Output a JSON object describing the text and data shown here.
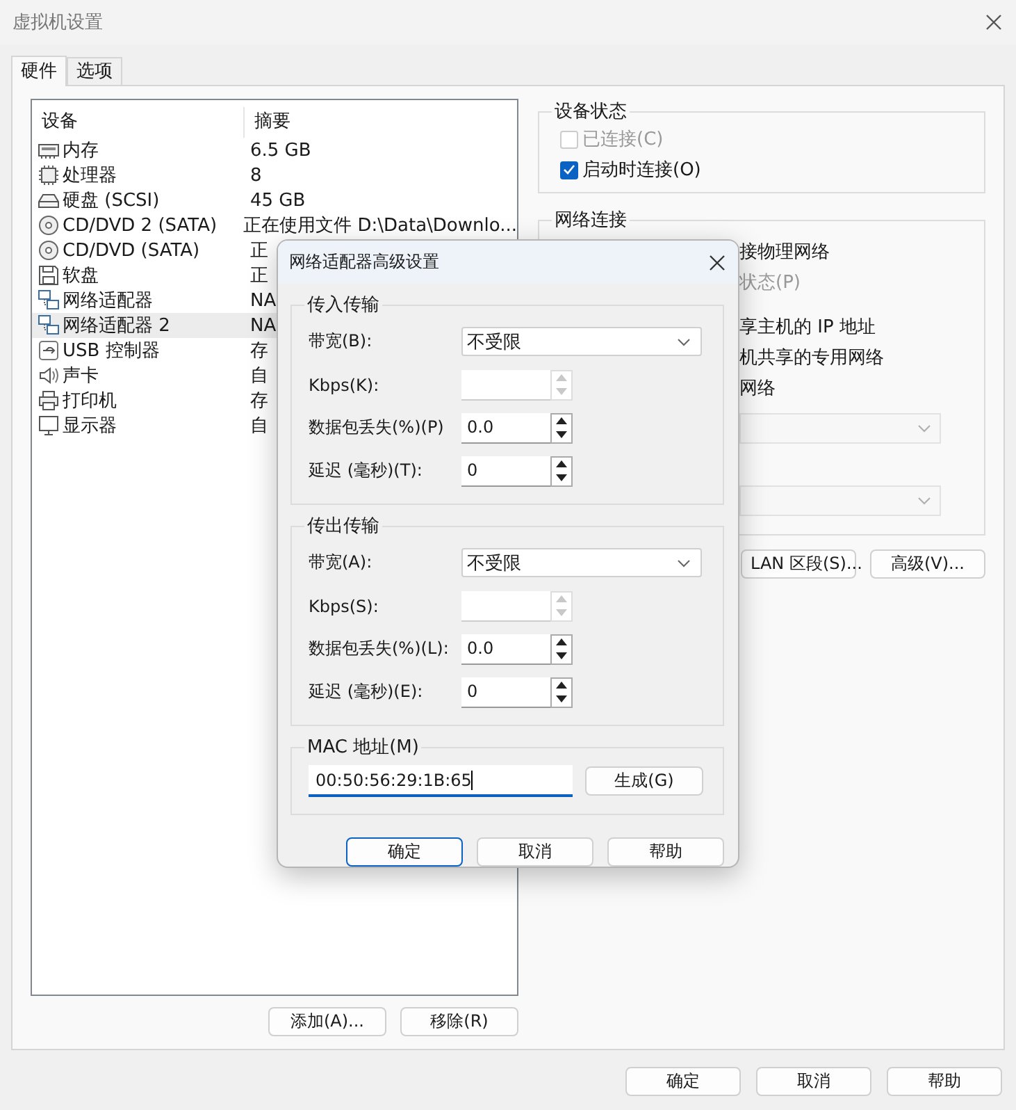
{
  "window": {
    "title": "虚拟机设置"
  },
  "tabs": [
    {
      "label": "硬件",
      "selected": true
    },
    {
      "label": "选项",
      "selected": false
    }
  ],
  "device_list": {
    "columns": [
      "设备",
      "摘要"
    ],
    "rows": [
      {
        "kind": "memory",
        "device": "内存",
        "summary": "6.5 GB",
        "selected": false
      },
      {
        "kind": "cpu",
        "device": "处理器",
        "summary": "8",
        "selected": false
      },
      {
        "kind": "disk",
        "device": "硬盘 (SCSI)",
        "summary": "45 GB",
        "selected": false
      },
      {
        "kind": "cdrom",
        "device": "CD/DVD 2 (SATA)",
        "summary": "正在使用文件 D:\\Data\\Downlo...",
        "selected": false
      },
      {
        "kind": "cdrom",
        "device": "CD/DVD (SATA)",
        "summary": "正",
        "selected": false
      },
      {
        "kind": "floppy",
        "device": "软盘",
        "summary": "正",
        "selected": false
      },
      {
        "kind": "network",
        "device": "网络适配器",
        "summary": "NA",
        "selected": false
      },
      {
        "kind": "network",
        "device": "网络适配器 2",
        "summary": "NA",
        "selected": true
      },
      {
        "kind": "usb",
        "device": "USB 控制器",
        "summary": "存",
        "selected": false
      },
      {
        "kind": "sound",
        "device": "声卡",
        "summary": "自",
        "selected": false
      },
      {
        "kind": "printer",
        "device": "打印机",
        "summary": "存",
        "selected": false
      },
      {
        "kind": "display",
        "device": "显示器",
        "summary": "自",
        "selected": false
      }
    ]
  },
  "list_buttons": [
    "添加(A)...",
    "移除(R)"
  ],
  "device_status": {
    "title": "设备状态",
    "options": [
      {
        "label": "已连接(C)",
        "checked": false,
        "disabled": true
      },
      {
        "label": "启动时连接(O)",
        "checked": true,
        "disabled": false
      }
    ]
  },
  "network_connection": {
    "title": "网络连接",
    "items": [
      {
        "kind": "text",
        "text": "接物理网络",
        "disabled": false
      },
      {
        "kind": "text",
        "text": "状态(P)",
        "disabled": true
      },
      {
        "kind": "text",
        "text": "享主机的 IP 地址",
        "disabled": false
      },
      {
        "kind": "text",
        "text": "机共享的专用网络",
        "disabled": false
      },
      {
        "kind": "text",
        "text": "网络",
        "disabled": false
      },
      {
        "kind": "dropdown",
        "disabled": true
      },
      {
        "kind": "dropdown",
        "disabled": true
      }
    ],
    "buttons": [
      "LAN 区段(S)...",
      "高级(V)..."
    ]
  },
  "buttons": [
    "确定",
    "取消",
    "帮助"
  ],
  "dialog": {
    "title": "网络适配器高级设置",
    "groups": [
      {
        "title": "传入传输",
        "fields": [
          {
            "kind": "combo",
            "label": "带宽(B):",
            "value": "不受限",
            "disabled": false
          },
          {
            "kind": "spin",
            "label": "Kbps(K):",
            "disabled": true
          },
          {
            "kind": "spin",
            "label": "数据包丢失(%)(P)",
            "value": "0.0",
            "disabled": false
          },
          {
            "kind": "spin",
            "label": "延迟 (毫秒)(T):",
            "value": "0",
            "disabled": false
          }
        ]
      },
      {
        "title": "传出传输",
        "fields": [
          {
            "kind": "combo",
            "label": "带宽(A):",
            "value": "不受限",
            "disabled": false
          },
          {
            "kind": "spin",
            "label": "Kbps(S):",
            "disabled": true
          },
          {
            "kind": "spin",
            "label": "数据包丢失(%)(L):",
            "value": "0.0",
            "disabled": false
          },
          {
            "kind": "spin",
            "label": "延迟 (毫秒)(E):",
            "value": "0",
            "disabled": false
          }
        ]
      }
    ],
    "mac": {
      "title": "MAC 地址(M)",
      "value": "00:50:56:29:1B:65",
      "button": "生成(G)"
    },
    "buttons": [
      {
        "label": "确定",
        "focused": true
      },
      {
        "label": "取消",
        "focused": false
      },
      {
        "label": "帮助",
        "focused": false
      }
    ]
  }
}
